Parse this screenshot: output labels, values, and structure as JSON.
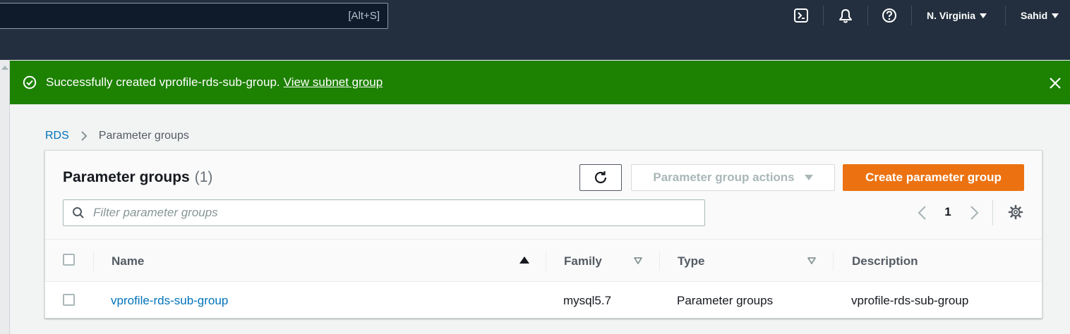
{
  "topnav": {
    "search_shortcut": "[Alt+S]",
    "region": "N. Virginia",
    "user": "Sahid",
    "icons": [
      "cloudshell-icon",
      "bell-icon",
      "help-icon"
    ]
  },
  "flash": {
    "message": "Successfully created vprofile-rds-sub-group.",
    "link": "View subnet group"
  },
  "breadcrumb": {
    "root": "RDS",
    "current": "Parameter groups"
  },
  "panel": {
    "title": "Parameter groups",
    "count": "(1)",
    "actions_label": "Parameter group actions",
    "create_label": "Create parameter group",
    "filter_placeholder": "Filter parameter groups",
    "page_number": "1"
  },
  "table": {
    "columns": [
      "Name",
      "Family",
      "Type",
      "Description"
    ],
    "rows": [
      {
        "name": "vprofile-rds-sub-group",
        "family": "mysql5.7",
        "type": "Parameter groups",
        "description": "vprofile-rds-sub-group"
      }
    ]
  },
  "colors": {
    "nav_bg": "#232f3e",
    "success": "#1d8102",
    "primary_button": "#ec7211",
    "link": "#0073bb"
  }
}
